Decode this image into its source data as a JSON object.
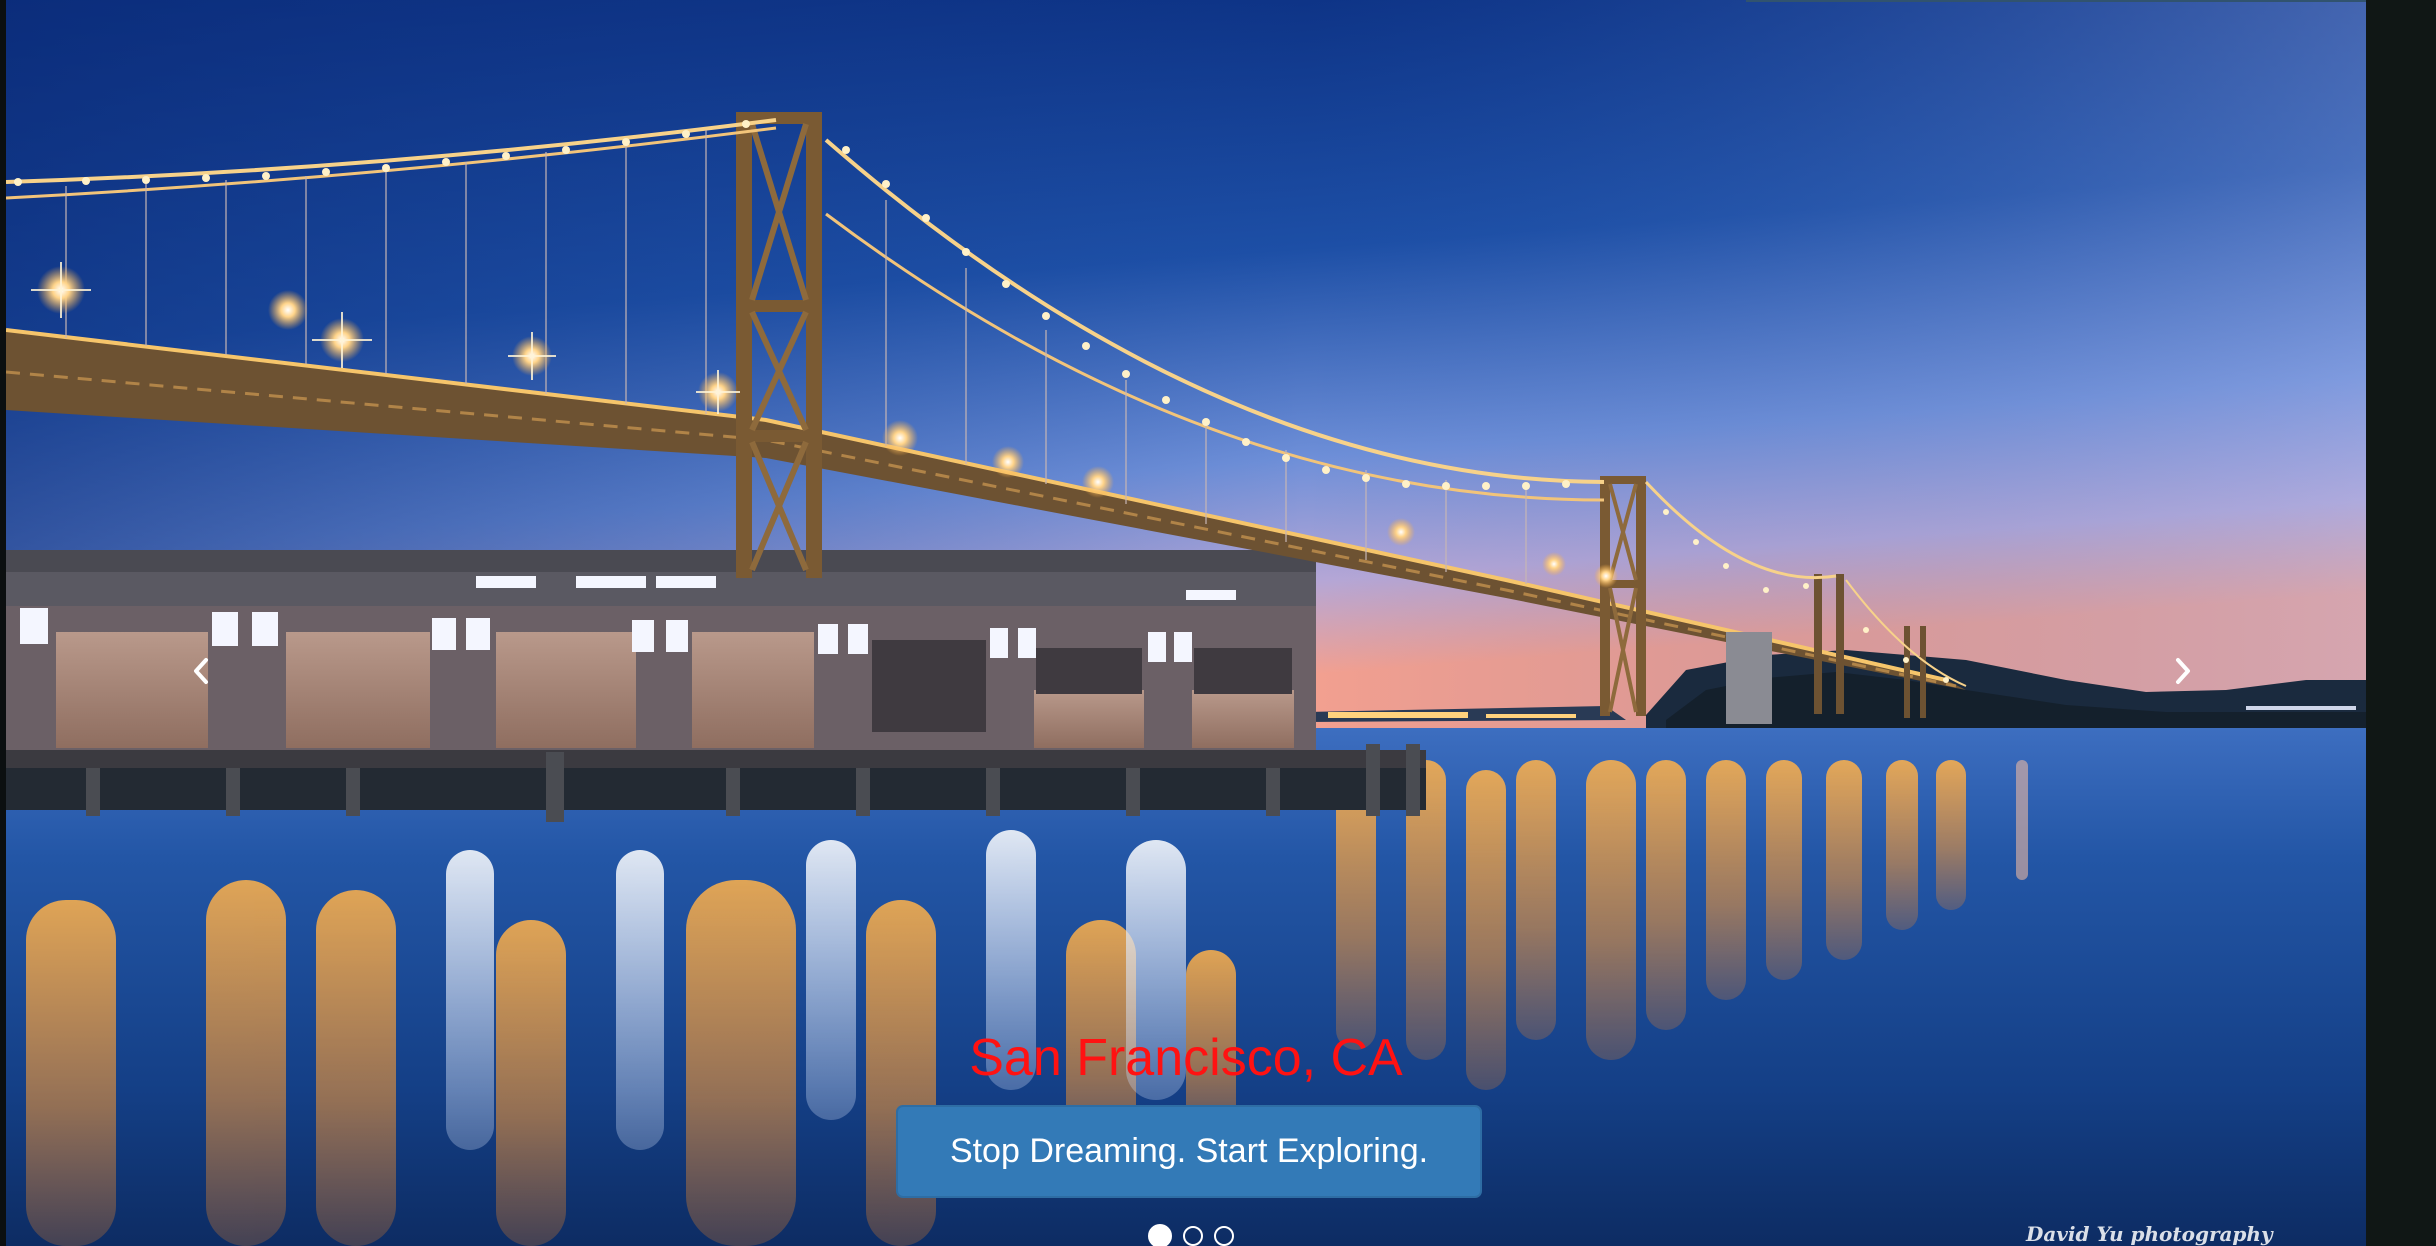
{
  "carousel": {
    "slide": {
      "title": "San Francisco, CA",
      "cta_label": "Stop Dreaming. Start Exploring.",
      "photo_credit": "David Yu photography"
    },
    "controls": {
      "prev_icon": "chevron-left-icon",
      "next_icon": "chevron-right-icon"
    },
    "indicators": [
      {
        "active": true
      },
      {
        "active": false
      },
      {
        "active": false
      }
    ]
  },
  "colors": {
    "caption": "#ff1212",
    "button": "#337ab7",
    "sky_top": "#0a2f78",
    "sky_horizon": "#f0a294",
    "water": "#123a7a"
  }
}
